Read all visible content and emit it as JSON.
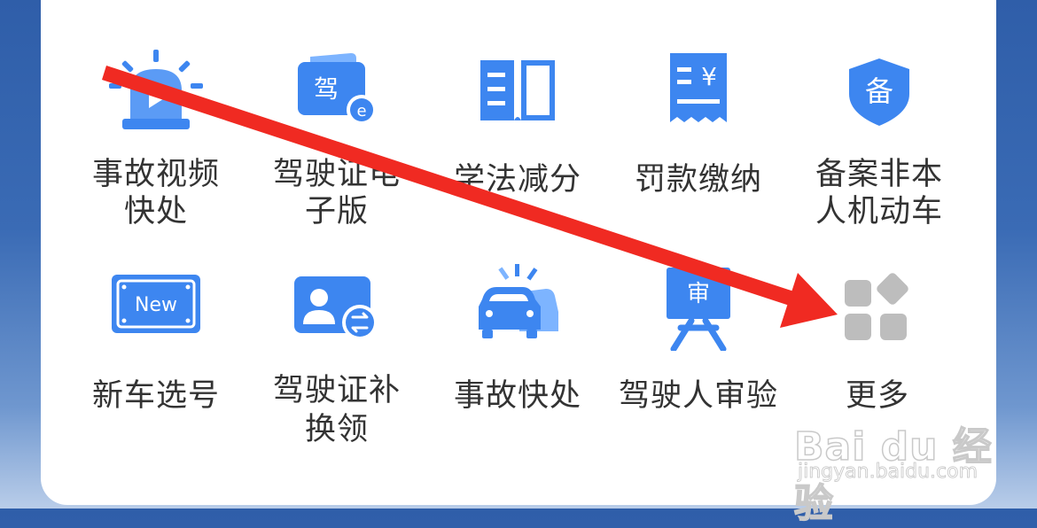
{
  "row1": [
    {
      "label_line1": "事故视频",
      "label_line2": "快处",
      "icon": "alarm-siren-icon"
    },
    {
      "label_line1": "驾驶证电",
      "label_line2": "子版",
      "icon": "license-e-icon",
      "icon_text": "驾"
    },
    {
      "label_line1": "学法减分",
      "label_line2": "",
      "icon": "book-icon"
    },
    {
      "label_line1": "罚款缴纳",
      "label_line2": "",
      "icon": "receipt-yen-icon",
      "icon_text": "¥"
    },
    {
      "label_line1": "备案非本",
      "label_line2": "人机动车",
      "icon": "shield-icon",
      "icon_text": "备"
    }
  ],
  "row2": [
    {
      "label_line1": "新车选号",
      "label_line2": "",
      "icon": "new-plate-icon",
      "icon_text": "New"
    },
    {
      "label_line1": "驾驶证补",
      "label_line2": "换领",
      "icon": "license-renew-icon"
    },
    {
      "label_line1": "事故快处",
      "label_line2": "",
      "icon": "car-collision-icon"
    },
    {
      "label_line1": "驾驶人审验",
      "label_line2": "",
      "icon": "audit-board-icon",
      "icon_text": "审"
    },
    {
      "label_line1": "更多",
      "label_line2": "",
      "icon": "more-grid-icon"
    }
  ],
  "watermark": {
    "main": "Bai du 经验",
    "sub": "jingyan.baidu.com"
  },
  "colors": {
    "icon_blue": "#3d86f0",
    "icon_blue_light": "#7db4ff",
    "more_gray": "#bdbdbd",
    "annotation_arrow": "#f02a22"
  }
}
